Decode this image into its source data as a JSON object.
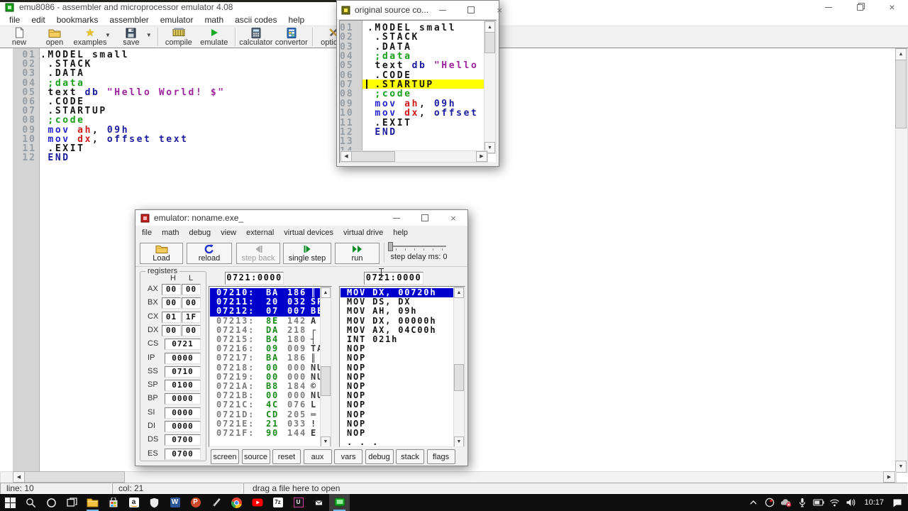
{
  "colors": {
    "selection_blue": "#0000cc",
    "highlight_yellow": "#ffff00",
    "hex_green": "#178a17",
    "comment_green": "#17a017",
    "directive_navy": "#1a1a9c",
    "register_red": "#cf1a1a",
    "mnemonic_blue": "#2424cf",
    "string_purple": "#9c249c"
  },
  "main_window": {
    "title": "emu8086 - assembler and microprocessor emulator 4.08",
    "menu": [
      "file",
      "edit",
      "bookmarks",
      "assembler",
      "emulator",
      "math",
      "ascii codes",
      "help"
    ],
    "toolbar": [
      {
        "label": "new",
        "icon": "new-document-icon"
      },
      {
        "label": "open",
        "icon": "open-folder-icon"
      },
      {
        "label": "examples",
        "icon": "examples-star-icon",
        "dropdown": true
      },
      {
        "label": "save",
        "icon": "save-floppy-icon",
        "dropdown": true
      },
      {
        "label": "compile",
        "icon": "compile-icon",
        "sep_before": true
      },
      {
        "label": "emulate",
        "icon": "emulate-play-icon"
      },
      {
        "label": "calculator",
        "icon": "calculator-icon",
        "sep_before": true
      },
      {
        "label": "convertor",
        "icon": "convertor-icon"
      },
      {
        "label": "options",
        "icon": "options-tools-icon",
        "sep_before": true
      }
    ],
    "status_bar": {
      "line_indicator": "line: 10",
      "col_indicator": "col: 21",
      "drop_hint": "drag a file here to open"
    }
  },
  "source_code": {
    "lines": [
      {
        "num": "01",
        "tokens": [
          [
            ".MODEL small",
            "k"
          ]
        ]
      },
      {
        "num": "02",
        "tokens": [
          [
            " .STACK",
            "k"
          ]
        ]
      },
      {
        "num": "03",
        "tokens": [
          [
            " .DATA",
            "k"
          ]
        ]
      },
      {
        "num": "04",
        "tokens": [
          [
            " ;data",
            "c"
          ]
        ]
      },
      {
        "num": "05",
        "tokens": [
          [
            " text ",
            "k"
          ],
          [
            "db ",
            "d"
          ],
          [
            "\"Hello World! $\"",
            "s"
          ]
        ]
      },
      {
        "num": "06",
        "tokens": [
          [
            " .CODE",
            "k"
          ]
        ]
      },
      {
        "num": "07",
        "tokens": [
          [
            " .STARTUP",
            "k"
          ]
        ]
      },
      {
        "num": "08",
        "tokens": [
          [
            " ;code",
            "c"
          ]
        ]
      },
      {
        "num": "09",
        "tokens": [
          [
            " mov ",
            "m"
          ],
          [
            "ah",
            "r"
          ],
          [
            ", ",
            "k"
          ],
          [
            "09h",
            "d"
          ]
        ]
      },
      {
        "num": "10",
        "tokens": [
          [
            " mov ",
            "m"
          ],
          [
            "dx",
            "r"
          ],
          [
            ", ",
            "k"
          ],
          [
            "offset text",
            "d"
          ]
        ]
      },
      {
        "num": "11",
        "tokens": [
          [
            " .EXIT",
            "k"
          ]
        ]
      },
      {
        "num": "12",
        "tokens": [
          [
            " END",
            "d"
          ]
        ]
      }
    ]
  },
  "popup_window": {
    "title": "original source co...",
    "highlight_line_num": "07",
    "extra_line_nums": [
      "13",
      "14"
    ]
  },
  "emulator_window": {
    "title": "emulator: noname.exe_",
    "menu": [
      "file",
      "math",
      "debug",
      "view",
      "external",
      "virtual devices",
      "virtual drive",
      "help"
    ],
    "toolbar": [
      {
        "label": "Load",
        "icon": "load-folder-icon"
      },
      {
        "label": "reload",
        "icon": "reload-icon"
      },
      {
        "label": "step back",
        "icon": "step-back-icon",
        "disabled": true
      },
      {
        "label": "single step",
        "icon": "single-step-icon"
      },
      {
        "label": "run",
        "icon": "run-icon"
      }
    ],
    "step_delay_label": "step delay ms: 0",
    "registers_panel": {
      "legend": "registers",
      "col_headers": [
        "H",
        "L"
      ],
      "pair_registers": [
        {
          "name": "AX",
          "h": "00",
          "l": "00"
        },
        {
          "name": "BX",
          "h": "00",
          "l": "00"
        },
        {
          "name": "CX",
          "h": "01",
          "l": "1F"
        },
        {
          "name": "DX",
          "h": "00",
          "l": "00"
        }
      ],
      "single_registers": [
        {
          "name": "CS",
          "value": "0721"
        },
        {
          "name": "IP",
          "value": "0000"
        },
        {
          "name": "SS",
          "value": "0710"
        },
        {
          "name": "SP",
          "value": "0100"
        },
        {
          "name": "BP",
          "value": "0000"
        },
        {
          "name": "SI",
          "value": "0000"
        },
        {
          "name": "DI",
          "value": "0000"
        },
        {
          "name": "DS",
          "value": "0700"
        },
        {
          "name": "ES",
          "value": "0700"
        }
      ]
    },
    "memory_address_field": "0721:0000",
    "disasm_address_field": "0721:0000",
    "memory_rows": [
      {
        "addr": "07210:",
        "hex": "BA",
        "dec": "186",
        "ch": "║",
        "selected": true
      },
      {
        "addr": "07211:",
        "hex": "20",
        "dec": "032",
        "ch": "SP",
        "selected": true
      },
      {
        "addr": "07212:",
        "hex": "07",
        "dec": "007",
        "ch": "BE",
        "selected": true
      },
      {
        "addr": "07213:",
        "hex": "8E",
        "dec": "142",
        "ch": "Ä"
      },
      {
        "addr": "07214:",
        "hex": "DA",
        "dec": "218",
        "ch": "┌"
      },
      {
        "addr": "07215:",
        "hex": "B4",
        "dec": "180",
        "ch": "┤"
      },
      {
        "addr": "07216:",
        "hex": "09",
        "dec": "009",
        "ch": "TA"
      },
      {
        "addr": "07217:",
        "hex": "BA",
        "dec": "186",
        "ch": "║"
      },
      {
        "addr": "07218:",
        "hex": "00",
        "dec": "000",
        "ch": "NU"
      },
      {
        "addr": "07219:",
        "hex": "00",
        "dec": "000",
        "ch": "NU"
      },
      {
        "addr": "0721A:",
        "hex": "B8",
        "dec": "184",
        "ch": "©"
      },
      {
        "addr": "0721B:",
        "hex": "00",
        "dec": "000",
        "ch": "NU"
      },
      {
        "addr": "0721C:",
        "hex": "4C",
        "dec": "076",
        "ch": "L"
      },
      {
        "addr": "0721D:",
        "hex": "CD",
        "dec": "205",
        "ch": "═"
      },
      {
        "addr": "0721E:",
        "hex": "21",
        "dec": "033",
        "ch": "!"
      },
      {
        "addr": "0721F:",
        "hex": "90",
        "dec": "144",
        "ch": "É"
      }
    ],
    "disassembly_rows": [
      "MOV DX, 00720h",
      "MOV DS, DX",
      "MOV AH, 09h",
      "MOV DX, 00000h",
      "MOV AX, 04C00h",
      "INT 021h",
      "NOP",
      "NOP",
      "NOP",
      "NOP",
      "NOP",
      "NOP",
      "NOP",
      "NOP",
      "NOP",
      "NOP",
      ". . ."
    ],
    "disassembly_selected_index": 0,
    "bottom_buttons": [
      "screen",
      "source",
      "reset",
      "aux",
      "vars",
      "debug",
      "stack",
      "flags"
    ]
  },
  "taskbar": {
    "items": [
      {
        "icon": "start-icon"
      },
      {
        "icon": "search-icon"
      },
      {
        "icon": "cortana-icon"
      },
      {
        "icon": "task-view-icon"
      },
      {
        "icon": "explorer-icon",
        "open": true
      },
      {
        "icon": "store-icon"
      },
      {
        "icon": "amazon-icon"
      },
      {
        "icon": "defender-icon"
      },
      {
        "icon": "word-icon"
      },
      {
        "icon": "powerpoint-icon"
      },
      {
        "icon": "snip-pen-icon"
      },
      {
        "icon": "chrome-icon"
      },
      {
        "icon": "youtube-icon"
      },
      {
        "icon": "7zip-icon"
      },
      {
        "icon": "ide-icon"
      },
      {
        "icon": "mail-icon"
      },
      {
        "icon": "emu8086-icon",
        "open": true,
        "active": true
      }
    ],
    "tray_icons": [
      "chevron-up-icon",
      "obs-icon",
      "onedrive-icon",
      "mic-icon",
      "battery-icon",
      "wifi-icon",
      "volume-icon"
    ],
    "clock": "10:17",
    "action_center_icon": "action-center-icon"
  }
}
